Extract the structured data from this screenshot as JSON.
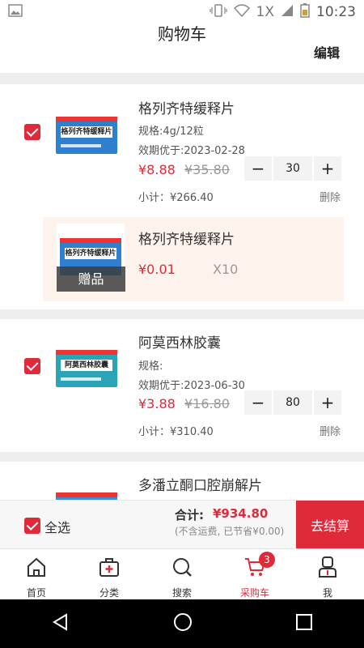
{
  "status_bar": {
    "time": "10:23",
    "network": "1X"
  },
  "header": {
    "title": "购物车",
    "edit_label": "编辑"
  },
  "items": [
    {
      "name": "格列齐特缓释片",
      "box_label": "格列齐特缓释片",
      "spec": "规格:4g/12粒",
      "expiry": "效期优于:2023-02-28",
      "price": "¥8.88",
      "original_price": "¥35.80",
      "quantity": "30",
      "subtotal": "小计：¥266.40",
      "delete_label": "删除",
      "gift": {
        "name": "格列齐特缓释片",
        "price": "¥0.01",
        "count": "X10",
        "badge": "赠品"
      }
    },
    {
      "name": "阿莫西林胶囊",
      "box_label": "阿莫西林胶囊",
      "spec": "规格:",
      "expiry": "效期优于:2023-06-30",
      "price": "¥3.88",
      "original_price": "¥16.80",
      "quantity": "80",
      "subtotal": "小计：¥310.40",
      "delete_label": "删除"
    },
    {
      "name": "多潘立酮口腔崩解片"
    }
  ],
  "stepper": {
    "minus": "−",
    "plus": "+"
  },
  "footer": {
    "select_all": "全选",
    "total_label": "合计:",
    "total_value": "¥934.80",
    "note": "(不含运费, 已节省¥0.00)",
    "checkout_label": "去结算"
  },
  "tabs": [
    {
      "label": "首页",
      "icon": "home-icon"
    },
    {
      "label": "分类",
      "icon": "medkit-icon"
    },
    {
      "label": "搜索",
      "icon": "search-icon"
    },
    {
      "label": "采购车",
      "icon": "cart-icon",
      "badge": "3",
      "active": true
    },
    {
      "label": "我",
      "icon": "user-icon"
    }
  ],
  "colors": {
    "accent": "#e02a3a",
    "gift_bg": "#fdf2ec"
  }
}
